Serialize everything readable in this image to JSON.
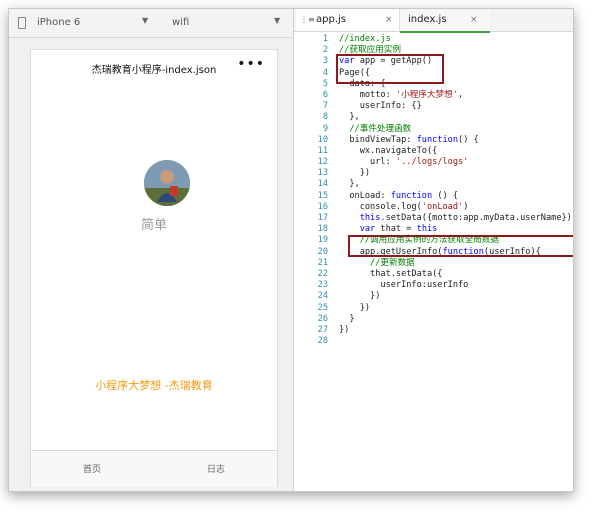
{
  "simulator": {
    "device": "iPhone 6",
    "network": "wifi",
    "nav_title": "杰瑞教育小程序-index.json",
    "more_glyph": "•••",
    "nickname": "简单",
    "motto": "小程序大梦想 -杰瑞教育",
    "tabs": {
      "home": "首页",
      "log": "日志"
    }
  },
  "editor": {
    "tabs": [
      {
        "label": "app.js",
        "close": "×"
      },
      {
        "label": "index.js",
        "close": "×"
      }
    ],
    "lines": [
      {
        "n": "1",
        "code": "//index.js"
      },
      {
        "n": "2",
        "code": "//获取应用实例"
      },
      {
        "n": "3",
        "code": "var app = getApp()"
      },
      {
        "n": "4",
        "code": "Page({"
      },
      {
        "n": "5",
        "code": "  data: {"
      },
      {
        "n": "6",
        "code": "    motto: '小程序大梦想',"
      },
      {
        "n": "7",
        "code": "    userInfo: {}"
      },
      {
        "n": "8",
        "code": "  },"
      },
      {
        "n": "9",
        "code": "  //事件处理函数"
      },
      {
        "n": "10",
        "code": "  bindViewTap: function() {"
      },
      {
        "n": "11",
        "code": "    wx.navigateTo({"
      },
      {
        "n": "12",
        "code": "      url: '../logs/logs'"
      },
      {
        "n": "13",
        "code": "    })"
      },
      {
        "n": "14",
        "code": "  },"
      },
      {
        "n": "15",
        "code": "  onLoad: function () {"
      },
      {
        "n": "16",
        "code": "    console.log('onLoad')"
      },
      {
        "n": "17",
        "code": "    this.setData({motto:app.myData.userName});"
      },
      {
        "n": "18",
        "code": "    var that = this"
      },
      {
        "n": "19",
        "code": "    //调用应用实例的方法获取全局数据"
      },
      {
        "n": "20",
        "code": "    app.getUserInfo(function(userInfo){"
      },
      {
        "n": "21",
        "code": "      //更新数据"
      },
      {
        "n": "22",
        "code": "      that.setData({"
      },
      {
        "n": "23",
        "code": "        userInfo:userInfo"
      },
      {
        "n": "24",
        "code": "      })"
      },
      {
        "n": "25",
        "code": "    })"
      },
      {
        "n": "26",
        "code": "  }"
      },
      {
        "n": "27",
        "code": "})"
      },
      {
        "n": "28",
        "code": ""
      }
    ]
  },
  "colors": {
    "motto": "#f39c12",
    "highlight_box": "#8b1a1a",
    "active_tab_underline": "#3fa73f",
    "comment": "#008000",
    "keyword": "#0000ff",
    "string": "#a31515",
    "line_number": "#2b91af"
  }
}
